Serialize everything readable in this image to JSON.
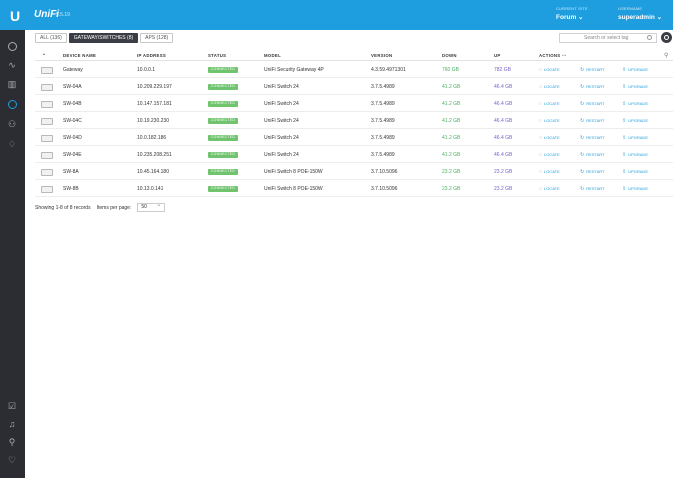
{
  "app": {
    "logo": "U",
    "brand": "UniFi",
    "version": "5.5.19"
  },
  "header": {
    "site_caption": "CURRENT SITE",
    "site_value": "Forum",
    "user_caption": "USERNAME",
    "user_value": "superadmin"
  },
  "sidebar": {
    "items": [
      {
        "name": "dashboard-icon",
        "active": false
      },
      {
        "name": "statistics-icon",
        "active": false
      },
      {
        "name": "map-icon",
        "active": false
      },
      {
        "name": "devices-icon",
        "active": true
      },
      {
        "name": "clients-icon",
        "active": false
      },
      {
        "name": "insights-icon",
        "active": false
      },
      {
        "name": "tasks-icon",
        "active": false
      },
      {
        "name": "alerts-icon",
        "active": false
      },
      {
        "name": "events-icon",
        "active": false
      },
      {
        "name": "chat-icon",
        "active": false
      }
    ]
  },
  "filters": [
    {
      "label": "ALL (136)",
      "active": false
    },
    {
      "label": "GATEWAY/SWITCHES (8)",
      "active": true
    },
    {
      "label": "APS (128)",
      "active": false
    }
  ],
  "search": {
    "placeholder": "Search or select tag"
  },
  "table": {
    "headers": [
      "DEVICE NAME",
      "IP ADDRESS",
      "STATUS",
      "MODEL",
      "VERSION",
      "DOWN",
      "UP",
      "ACTIONS"
    ],
    "rows": [
      {
        "name": "Gateway",
        "ip": "10.0.0.1",
        "status": "CONNECTED",
        "model": "UniFi Security Gateway 4P",
        "version": "4.3.59.4971301",
        "down": "760 GB",
        "up": "782 GB"
      },
      {
        "name": "SW-04A",
        "ip": "10.209.229.197",
        "status": "CONNECTED",
        "model": "UniFi Switch 24",
        "version": "3.7.5.4989",
        "down": "41.2 GB",
        "up": "46.4 GB"
      },
      {
        "name": "SW-04B",
        "ip": "10.147.157.181",
        "status": "CONNECTED",
        "model": "UniFi Switch 24",
        "version": "3.7.5.4989",
        "down": "41.2 GB",
        "up": "46.4 GB"
      },
      {
        "name": "SW-04C",
        "ip": "10.19.230.230",
        "status": "CONNECTED",
        "model": "UniFi Switch 24",
        "version": "3.7.5.4989",
        "down": "41.2 GB",
        "up": "46.4 GB"
      },
      {
        "name": "SW-04D",
        "ip": "10.0.182.186",
        "status": "CONNECTED",
        "model": "UniFi Switch 24",
        "version": "3.7.5.4989",
        "down": "41.2 GB",
        "up": "46.4 GB"
      },
      {
        "name": "SW-04E",
        "ip": "10.235.208.251",
        "status": "CONNECTED",
        "model": "UniFi Switch 24",
        "version": "3.7.5.4989",
        "down": "41.2 GB",
        "up": "46.4 GB"
      },
      {
        "name": "SW-8A",
        "ip": "10.45.164.180",
        "status": "CONNECTED",
        "model": "UniFi Switch 8 POE-150W",
        "version": "3.7.10.5096",
        "down": "23.2 GB",
        "up": "23.2 GB"
      },
      {
        "name": "SW-8B",
        "ip": "10.13.0.141",
        "status": "CONNECTED",
        "model": "UniFi Switch 8 POE-150W",
        "version": "3.7.10.5096",
        "down": "23.2 GB",
        "up": "23.2 GB"
      }
    ]
  },
  "actions": {
    "locate": "LOCATE",
    "restart": "RESTART",
    "upgrade": "UPGRADE"
  },
  "footer": {
    "showing": "Showing 1-8 of 8 records",
    "per_page_label": "Items per page:",
    "per_page_value": "50"
  },
  "colors": {
    "accent": "#1e9ede",
    "sidebar": "#2b2d33",
    "connected": "#6fc46d",
    "down": "#4bb05e",
    "up": "#7a62ca"
  }
}
